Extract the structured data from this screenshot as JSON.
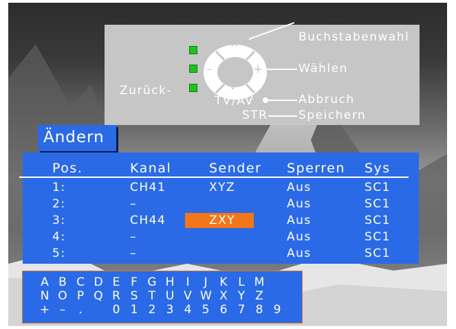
{
  "help": {
    "buchstabenwahl": "Buchstabenwahl",
    "waehlen": "Wählen",
    "zurueck": "Zurück-",
    "tvav": "TV/AV",
    "abbruch": "Abbruch",
    "str": "STR",
    "speichern": "Speichern",
    "up": "^",
    "down": "v",
    "minus": "–",
    "plus": "+"
  },
  "title": "Ändern",
  "table": {
    "headers": [
      "Pos.",
      "Kanal",
      "Sender",
      "Sperren",
      "Sys"
    ],
    "rows": [
      [
        "1:",
        "CH41",
        "XYZ",
        "Aus",
        "SC1"
      ],
      [
        "2:",
        "–",
        "",
        "Aus",
        "SC1"
      ],
      [
        "3:",
        "CH44",
        "ZXY",
        "Aus",
        "SC1"
      ],
      [
        "4:",
        "–",
        "",
        "Aus",
        "SC1"
      ],
      [
        "5:",
        "–",
        "",
        "Aus",
        "SC1"
      ]
    ]
  },
  "chars": {
    "row1": [
      "A",
      "B",
      "C",
      "D",
      "E",
      "F",
      "G",
      "H",
      "I",
      "J",
      "K",
      "L",
      "M"
    ],
    "row2": [
      "N",
      "O",
      "P",
      "Q",
      "R",
      "S",
      "T",
      "U",
      "V",
      "W",
      "X",
      "Y",
      "Z"
    ],
    "row3": [
      "+",
      "–",
      ".",
      "",
      "0",
      "1",
      "2",
      "3",
      "4",
      "5",
      "6",
      "7",
      "8",
      "9"
    ]
  },
  "colors": {
    "menu_blue": "#2b6ae6",
    "highlight_orange": "#f4761a",
    "help_gray": "#c6c6c6",
    "indicator_green": "#1ec31e"
  }
}
